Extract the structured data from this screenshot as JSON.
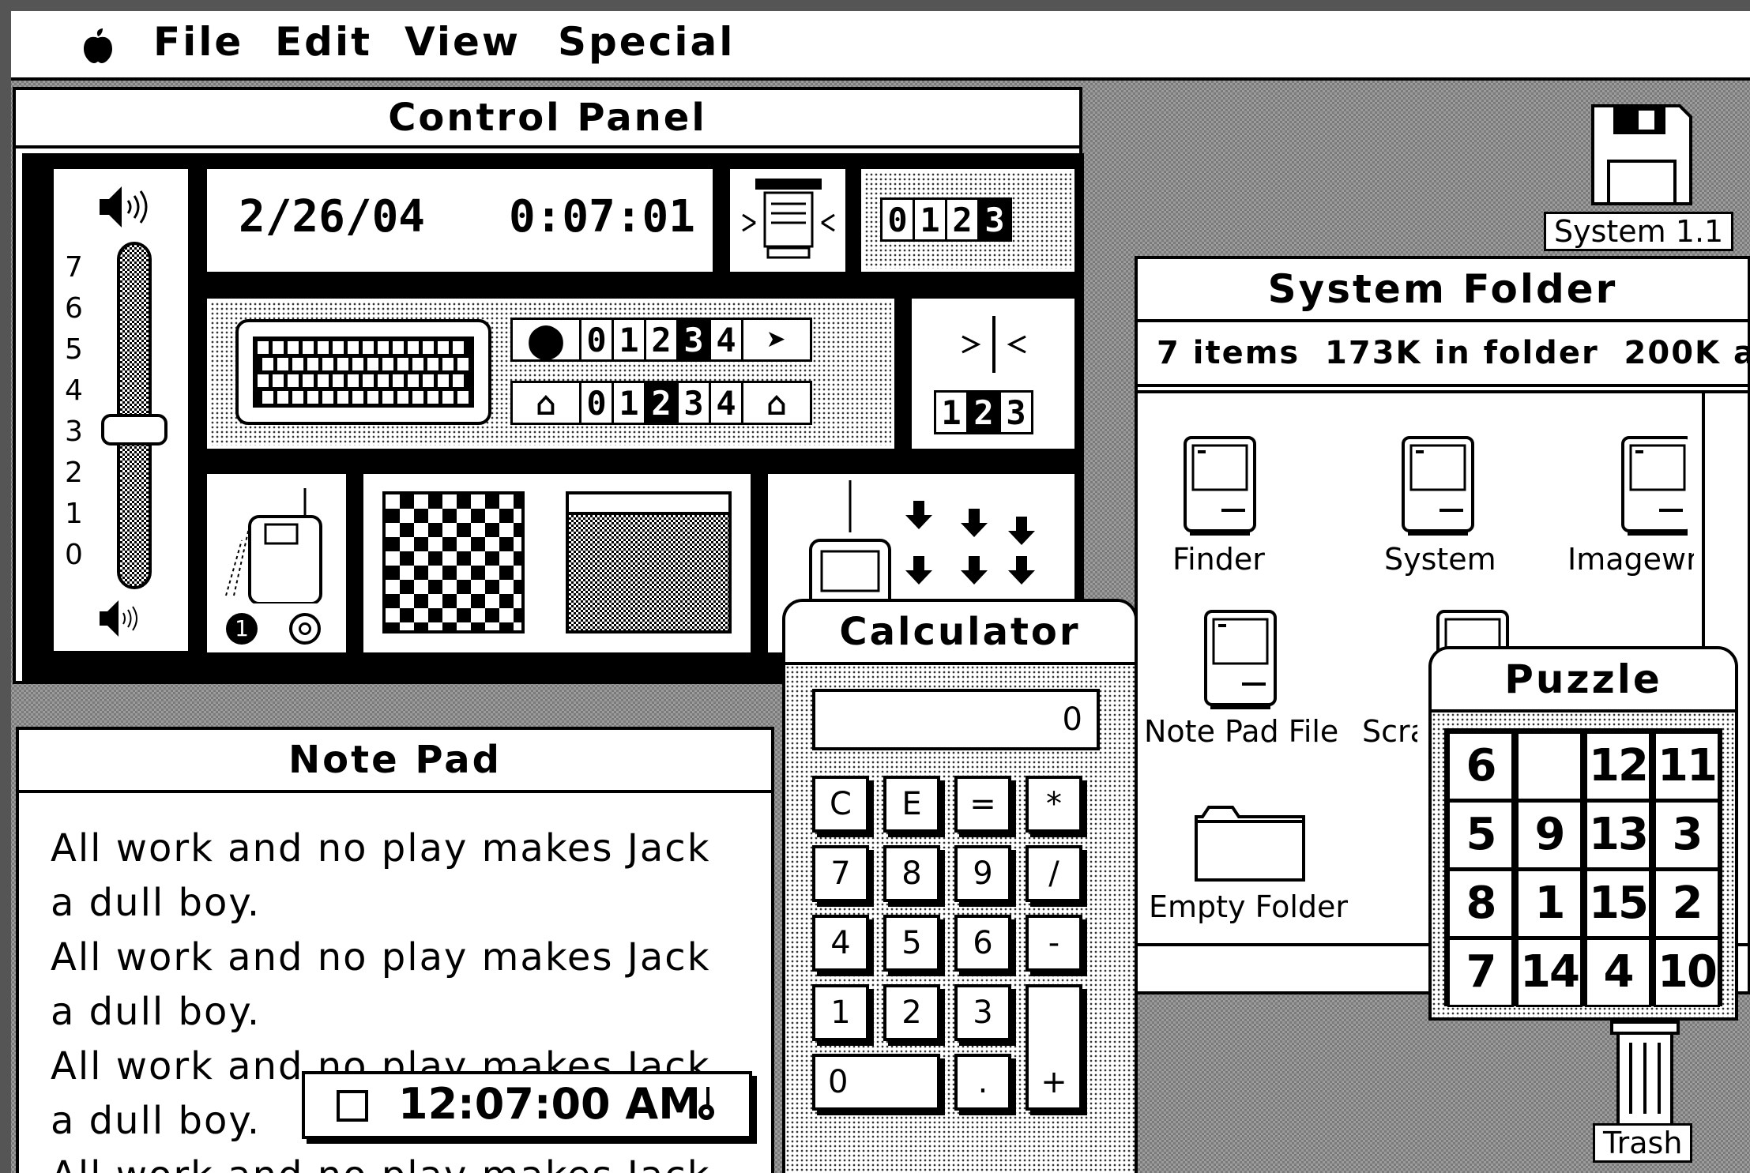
{
  "menubar": {
    "items": [
      "File",
      "Edit",
      "View",
      "Special"
    ]
  },
  "control_panel": {
    "title": "Control Panel",
    "date": "2/26/04",
    "time": "0:07:01",
    "volume_scale": [
      "7",
      "6",
      "5",
      "4",
      "3",
      "2",
      "1",
      "0"
    ],
    "volume_level": 3,
    "menu_blink_options": [
      "0",
      "1",
      "2",
      "3"
    ],
    "menu_blink_selected": 3,
    "key_repeat_options": [
      "0",
      "1",
      "2",
      "3",
      "4"
    ],
    "key_repeat_selected": 3,
    "key_delay_options": [
      "0",
      "1",
      "2",
      "3",
      "4"
    ],
    "key_delay_selected": 2,
    "caret_blink_options": [
      "1",
      "2",
      "3"
    ],
    "caret_blink_selected": 2,
    "port_labels": [
      "1"
    ]
  },
  "note_pad": {
    "title": "Note Pad",
    "lines": [
      "All work and no play makes Jack",
      "a dull boy.",
      "All work and no play makes Jack",
      "a dull boy.",
      "All work and no play makes Jack",
      "a dull boy.",
      "All work and no play makes Jack"
    ]
  },
  "alarm_clock": {
    "time": "12:07:00 AM"
  },
  "calculator": {
    "title": "Calculator",
    "display": "0",
    "keys": [
      "C",
      "E",
      "=",
      "*",
      "7",
      "8",
      "9",
      "/",
      "4",
      "5",
      "6",
      "-",
      "1",
      "2",
      "3",
      "0",
      ".",
      "+"
    ]
  },
  "system_folder": {
    "title": "System Folder",
    "info": "7 items  173K in folder  200K a",
    "icons": [
      "Finder",
      "System",
      "Imagewr",
      "Note Pad File",
      "Scra",
      "Empty Folder"
    ]
  },
  "puzzle": {
    "title": "Puzzle",
    "tiles": [
      "6",
      "",
      "12",
      "11",
      "5",
      "9",
      "13",
      "3",
      "8",
      "1",
      "15",
      "2",
      "7",
      "14",
      "4",
      "10"
    ]
  },
  "desktop": {
    "disk_label": "System 1.1",
    "trash_label": "Trash"
  }
}
